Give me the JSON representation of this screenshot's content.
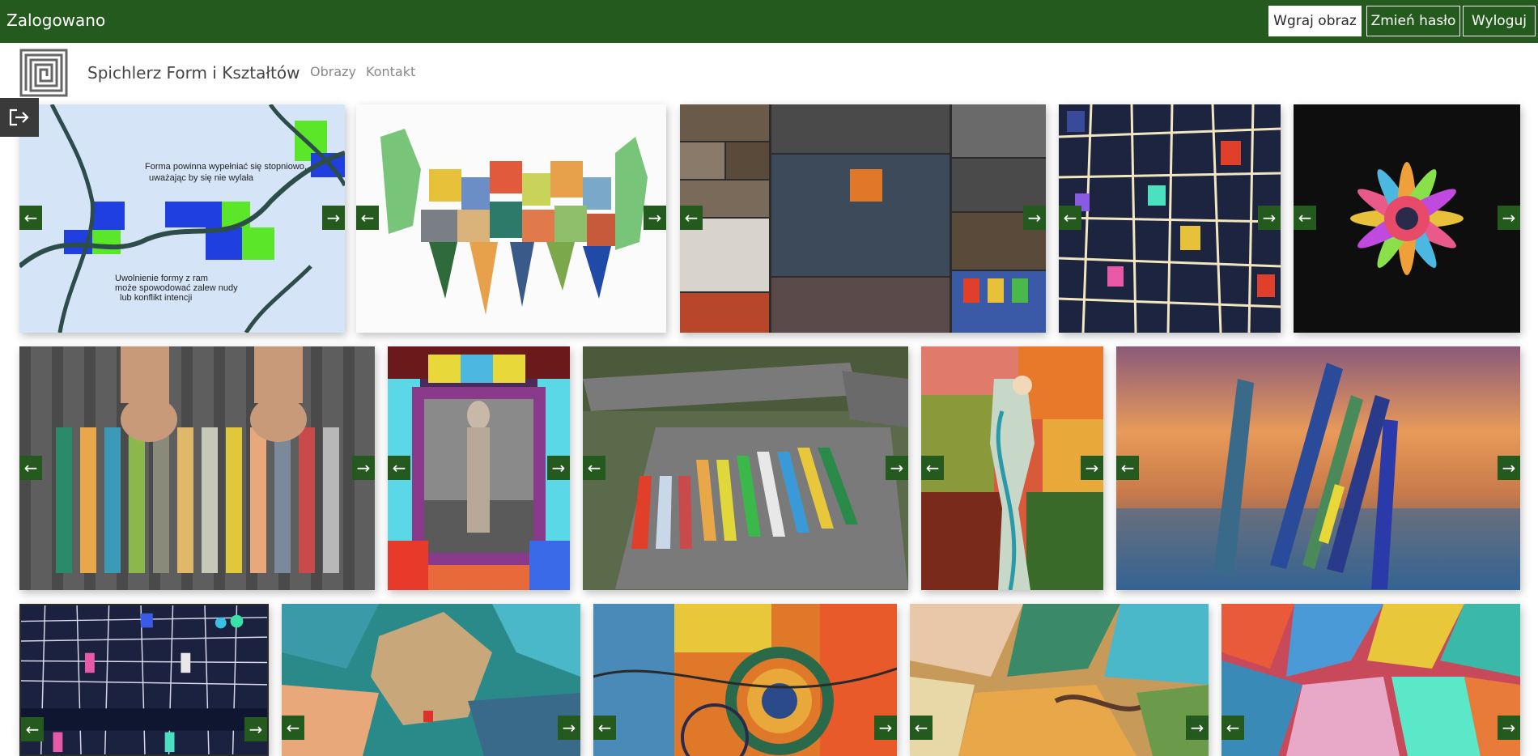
{
  "topbar": {
    "status": "Zalogowano",
    "upload_label": "Wgraj obraz",
    "change_password_label": "Zmień hasło",
    "logout_label": "Wyloguj"
  },
  "header": {
    "site_title": "Spichlerz Form i Kształtów",
    "nav": [
      "Obrazy",
      "Kontakt"
    ]
  },
  "gallery": {
    "prev_symbol": "←",
    "next_symbol": "→",
    "diagram_text_1": "Forma powinna wypełniać się stopniowo,",
    "diagram_text_2": "uważając by się nie wylała",
    "diagram_text_3": "Uwolnienie formy z ram",
    "diagram_text_4": "może spowodować zalew nudy",
    "diagram_text_5": "lub konflikt intencji"
  },
  "colors": {
    "brand_green": "#245a1e",
    "white": "#ffffff",
    "dark": "#3a3a3a"
  }
}
